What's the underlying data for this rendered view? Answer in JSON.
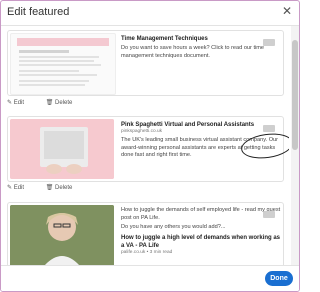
{
  "dialog": {
    "title": "Edit featured",
    "close_icon": "close-icon"
  },
  "items": [
    {
      "title": "Time Management Techniques",
      "description": "Do you want to save hours a week? Click to read our time management techniques document.",
      "url": "",
      "edit_label": "Edit",
      "delete_label": "Delete"
    },
    {
      "title": "Pink Spaghetti Virtual and Personal Assistants",
      "url": "pinkspaghetti.co.uk",
      "description": "The UK's leading small business virtual assistant company. Our award-winning personal assistants are experts at getting tasks done fast and right first time.",
      "edit_label": "Edit",
      "delete_label": "Delete"
    },
    {
      "title": "How to juggle the demands of self employed life - read my guest post on PA Life.",
      "description_line2": "Do you have any others you would add?...",
      "subtitle": "How to juggle a high level of demands when working as a VA - PA Life",
      "url": "palife.co.uk • 3 min read"
    }
  ],
  "footer": {
    "done_label": "Done"
  },
  "colors": {
    "accent": "#1a6fd1",
    "border": "#c99ac6",
    "pink_thumb": "#f6c9cf"
  }
}
